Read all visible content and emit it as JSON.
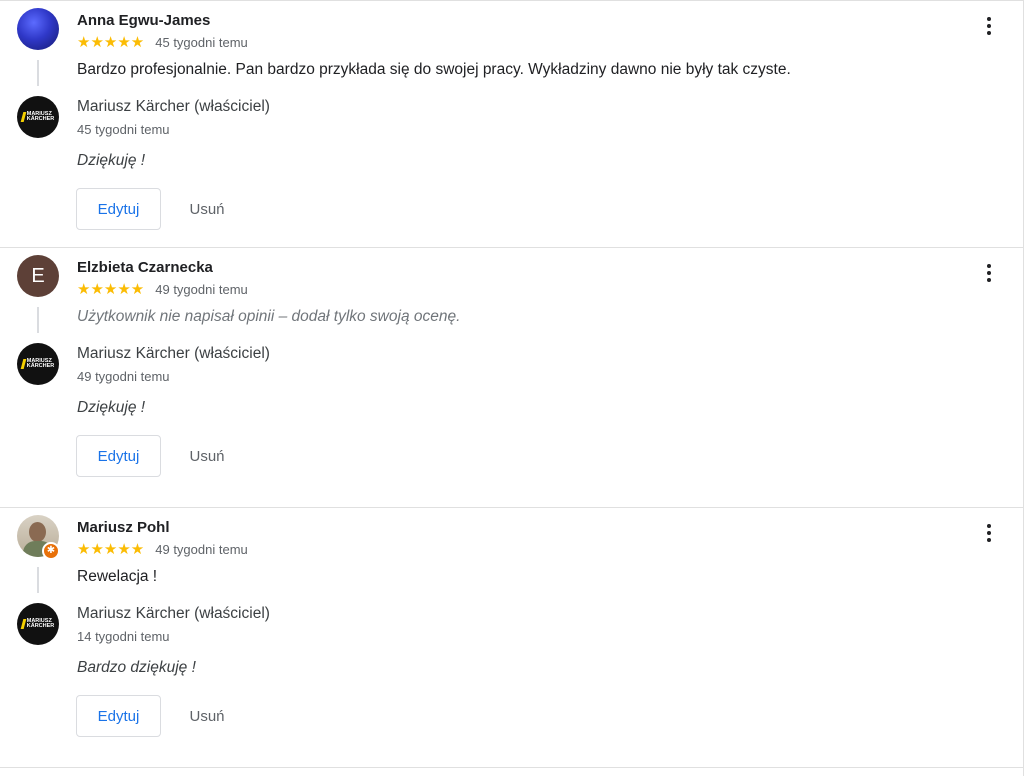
{
  "reviews": [
    {
      "reviewer_name": "Anna Egwu-James",
      "avatar": "photo",
      "stars": "★★★★★",
      "rating": 5,
      "time": "45 tygodni temu",
      "text": "Bardzo profesjonalnie. Pan bardzo przykłada się do swojej pracy. Wykładziny dawno nie były tak czyste.",
      "reply": {
        "owner_name": "Mariusz Kärcher (właściciel)",
        "time": "45 tygodni temu",
        "text": "Dziękuję !",
        "edit_label": "Edytuj",
        "delete_label": "Usuń"
      }
    },
    {
      "reviewer_name": "Elzbieta Czarnecka",
      "avatar_letter": "E",
      "stars": "★★★★★",
      "rating": 5,
      "time": "49 tygodni temu",
      "text": "Użytkownik nie napisał opinii – dodał tylko swoją ocenę.",
      "reply": {
        "owner_name": "Mariusz Kärcher (właściciel)",
        "time": "49 tygodni temu",
        "text": "Dziękuję !",
        "edit_label": "Edytuj",
        "delete_label": "Usuń"
      }
    },
    {
      "reviewer_name": "Mariusz Pohl",
      "avatar": "photo",
      "stars": "★★★★★",
      "rating": 5,
      "time": "49 tygodni temu",
      "text": "Rewelacja !",
      "reply": {
        "owner_name": "Mariusz Kärcher (właściciel)",
        "time": "14 tygodni temu",
        "text": "Bardzo dziękuję !",
        "edit_label": "Edytuj",
        "delete_label": "Usuń"
      }
    }
  ],
  "owner_logo": {
    "line1": "MARIUSZ",
    "line2": "KÄRCHER"
  },
  "icons": {
    "menu": "more-vert-icon",
    "star": "star-icon",
    "guide_badge": "local-guide-icon"
  },
  "colors": {
    "star": "#fbbc04",
    "edit_text": "#1a73e8",
    "letter_avatar": "#5d4037",
    "logo_stripe": "#f5d000"
  }
}
